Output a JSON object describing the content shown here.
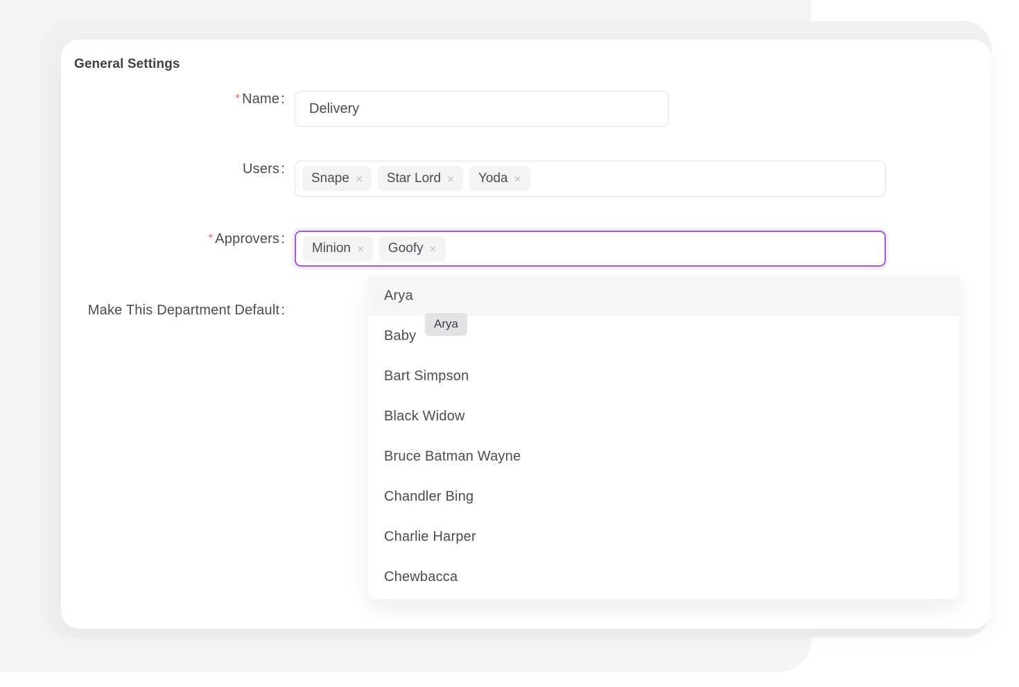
{
  "card": {
    "title": "General Settings"
  },
  "form": {
    "name": {
      "label": "Name",
      "required_marker": "*",
      "colon": ":",
      "value": "Delivery",
      "placeholder": ""
    },
    "users": {
      "label": "Users",
      "colon": ":",
      "chips": [
        {
          "label": "Snape",
          "remove_icon": "×"
        },
        {
          "label": "Star Lord",
          "remove_icon": "×"
        },
        {
          "label": "Yoda",
          "remove_icon": "×"
        }
      ]
    },
    "approvers": {
      "label": "Approvers",
      "required_marker": "*",
      "colon": ":",
      "focused": true,
      "chips": [
        {
          "label": "Minion",
          "remove_icon": "×"
        },
        {
          "label": "Goofy",
          "remove_icon": "×"
        }
      ]
    },
    "make_default": {
      "label": "Make This Department Default",
      "colon": ":"
    }
  },
  "dropdown": {
    "options": [
      {
        "label": "Arya",
        "highlighted": true
      },
      {
        "label": "Baby",
        "highlighted": false
      },
      {
        "label": "Bart Simpson",
        "highlighted": false
      },
      {
        "label": "Black Widow",
        "highlighted": false
      },
      {
        "label": "Bruce Batman Wayne",
        "highlighted": false
      },
      {
        "label": "Chandler Bing",
        "highlighted": false
      },
      {
        "label": "Charlie Harper",
        "highlighted": false
      },
      {
        "label": "Chewbacca",
        "highlighted": false
      }
    ]
  },
  "tooltip": {
    "text": "Arya"
  },
  "colors": {
    "accent_focus": "#a259e0",
    "required_asterisk": "#e05c5c",
    "text": "#4b4b52",
    "chip_bg": "#f4f4f5",
    "card_bg": "#ffffff",
    "page_bg": "#f4f4f5",
    "tooltip_bg": "#e3e3e5"
  }
}
